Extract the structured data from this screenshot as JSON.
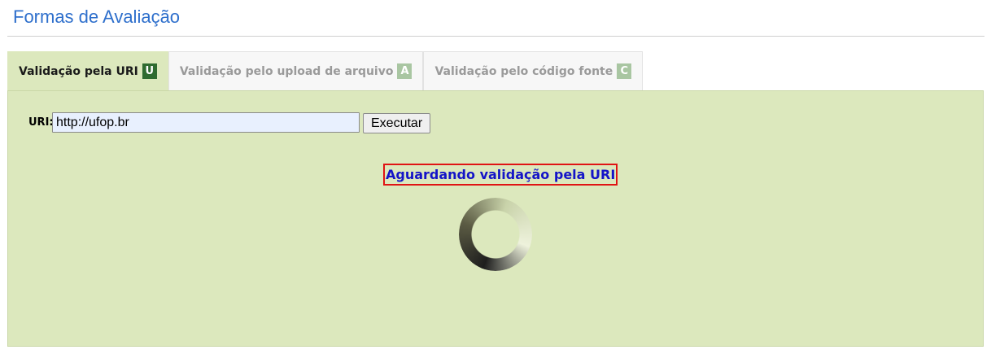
{
  "header": {
    "title": "Formas de Avaliação"
  },
  "tabs": [
    {
      "label": "Validação pela URI",
      "key": "U",
      "active": true
    },
    {
      "label": "Validação pelo upload de arquivo",
      "key": "A",
      "active": false
    },
    {
      "label": "Validação pelo código fonte",
      "key": "C",
      "active": false
    }
  ],
  "form": {
    "uri_label": "URI:",
    "uri_value": "http://ufop.br",
    "execute_label": "Executar"
  },
  "status": {
    "message": "Aguardando validação pela URI",
    "spinner_icon": "loading-spinner-icon"
  },
  "colors": {
    "title": "#2e6fcc",
    "panel_background": "#dce8bd",
    "active_key_badge": "#2f6b30",
    "inactive_key_badge": "#a9c6a2",
    "status_text": "#1414c8",
    "status_border": "#e01414"
  }
}
